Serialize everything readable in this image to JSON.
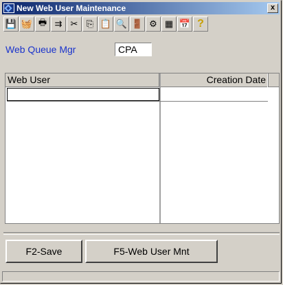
{
  "window": {
    "title": "New Web User Maintenance",
    "close_label": "x"
  },
  "toolbar": {
    "items": [
      {
        "icon": "save-icon",
        "glyph": "💾"
      },
      {
        "icon": "basket-icon",
        "glyph": "🧺"
      },
      {
        "icon": "print-icon",
        "glyph": "🖶"
      },
      {
        "icon": "run-icon",
        "glyph": "⇉"
      },
      {
        "icon": "cut-icon",
        "glyph": "✂"
      },
      {
        "icon": "copy-icon",
        "glyph": "⎘"
      },
      {
        "icon": "paste-icon",
        "glyph": "📋"
      },
      {
        "icon": "find-icon",
        "glyph": "🔍"
      },
      {
        "icon": "exit-door-icon",
        "glyph": "🚪"
      },
      {
        "icon": "tools-icon",
        "glyph": "⚙"
      },
      {
        "icon": "calculator-icon",
        "glyph": "▦"
      },
      {
        "icon": "calendar-icon",
        "glyph": "📅"
      },
      {
        "icon": "help-icon",
        "glyph": "?"
      }
    ]
  },
  "queue": {
    "label": "Web Queue Mgr",
    "value": "CPA"
  },
  "grid": {
    "columns": [
      "Web User",
      "Creation Date"
    ]
  },
  "buttons": {
    "save": "F2-Save",
    "web_user_mnt": "F5-Web User Mnt"
  }
}
